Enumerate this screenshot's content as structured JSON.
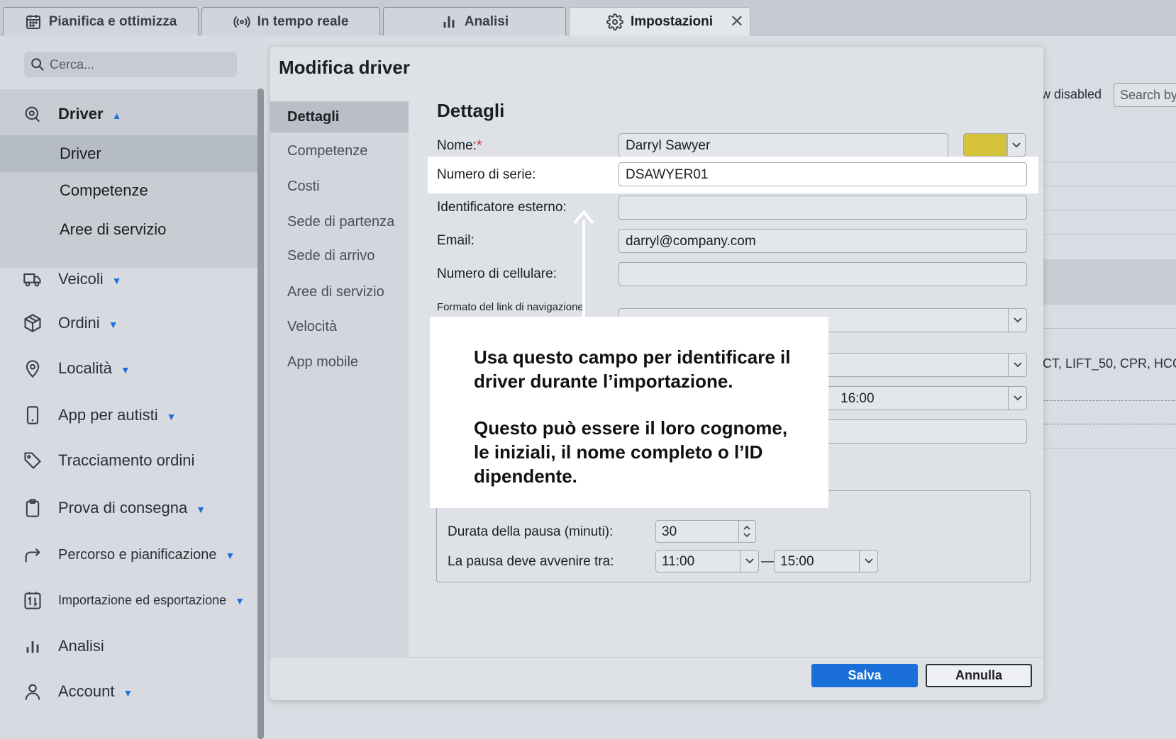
{
  "tabs": [
    {
      "label": "Pianifica e ottimizza",
      "icon": "calendar-icon"
    },
    {
      "label": "In tempo reale",
      "icon": "broadcast-icon"
    },
    {
      "label": "Analisi",
      "icon": "bar-chart-icon"
    },
    {
      "label": "Impostazioni",
      "icon": "gear-icon",
      "active": true
    }
  ],
  "tab_close": "✕",
  "sidebar": {
    "search_placeholder": "Cerca...",
    "driver_section": {
      "label": "Driver",
      "caret": "▲"
    },
    "driver_sub": [
      "Driver",
      "Competenze",
      "Aree di servizio"
    ],
    "items": [
      {
        "label": "Veicoli",
        "icon": "truck-icon",
        "caret": "▼"
      },
      {
        "label": "Ordini",
        "icon": "box-icon",
        "caret": "▼"
      },
      {
        "label": "Località",
        "icon": "location-pin-icon",
        "caret": "▼"
      },
      {
        "label": "App per autisti",
        "icon": "phone-icon",
        "caret": "▼"
      },
      {
        "label": "Tracciamento ordini",
        "icon": "tag-icon",
        "caret": ""
      },
      {
        "label": "Prova di consegna",
        "icon": "clipboard-icon",
        "caret": "▼"
      },
      {
        "label": "Percorso e pianificazione",
        "icon": "route-arrow-icon",
        "caret": "▼"
      },
      {
        "label": "Importazione ed esportazione",
        "icon": "import-export-icon",
        "caret": "▼"
      },
      {
        "label": "Analisi",
        "icon": "bar-chart-icon",
        "caret": ""
      },
      {
        "label": "Account",
        "icon": "user-icon",
        "caret": "▼"
      }
    ]
  },
  "background": {
    "disabled_text": "w disabled",
    "search_placeholder": "Search by",
    "skills_text": "CT, LIFT_50, CPR, HCC"
  },
  "dialog": {
    "title": "Modifica driver",
    "nav": [
      "Dettagli",
      "Competenze",
      "Costi",
      "Sede di partenza",
      "Sede di arrivo",
      "Aree di servizio",
      "Velocità",
      "App mobile"
    ],
    "section_title": "Dettagli",
    "fields": {
      "name_label": "Nome:",
      "name_required": "*",
      "name_value": "Darryl Sawyer",
      "color": "#d4c23a",
      "serial_label": "Numero di serie:",
      "serial_value": "DSAWYER01",
      "external_id_label": "Identificatore esterno:",
      "external_id_value": "",
      "email_label": "Email:",
      "email_value": "darryl@company.com",
      "mobile_label": "Numero di cellulare:",
      "mobile_value": "",
      "nav_link_label": "Formato del link di navigazione",
      "shift_end_value": "16:00"
    },
    "break": {
      "duration_label": "Durata della pausa (minuti):",
      "duration_value": "30",
      "between_label": "La pausa deve avvenire tra:",
      "from_value": "11:00",
      "separator": "—",
      "to_value": "15:00"
    },
    "save_label": "Salva",
    "cancel_label": "Annulla"
  },
  "callout": {
    "line1": "Usa questo campo per identificare il driver durante l’importazione.",
    "line2": "Questo può essere il loro cognome, le iniziali, il nome completo o l’ID dipendente."
  },
  "colors": {
    "accent": "#1a6fd8",
    "caret": "#1e6fd9",
    "highlight": "#ffffff"
  }
}
